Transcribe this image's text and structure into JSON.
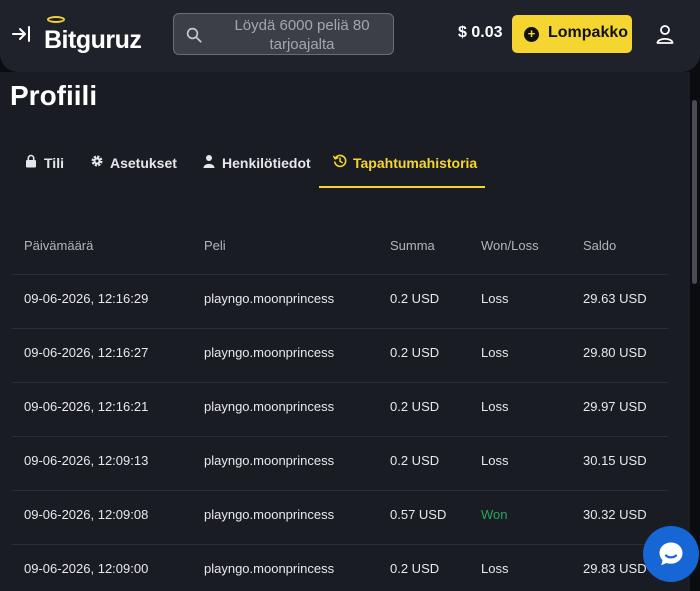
{
  "header": {
    "logo_text": "Bitguruz",
    "search_placeholder": "Löydä 6000 peliä 80 tarjoajalta",
    "balance": "$ 0.03",
    "wallet_label": "Lompakko",
    "wallet_plus": "+",
    "icons": {
      "collapse": "arrow-right-bar-icon",
      "search": "search-icon",
      "wallet": "plus-circle-icon",
      "user": "user-icon"
    }
  },
  "page": {
    "title": "Profiili",
    "tabs": [
      {
        "label": "Tili",
        "icon": "lock-icon",
        "active": false
      },
      {
        "label": "Asetukset",
        "icon": "gear-icon",
        "active": false
      },
      {
        "label": "Henkilötiedot",
        "icon": "person-icon",
        "active": false
      },
      {
        "label": "Tapahtumahistoria",
        "icon": "history-icon",
        "active": true
      }
    ]
  },
  "table": {
    "columns": [
      "Päivämäärä",
      "Peli",
      "Summa",
      "Won/Loss",
      "Saldo"
    ],
    "rows": [
      [
        "09-06-2026, 12:16:29",
        "playngo.moonprincess",
        "0.2 USD",
        "Loss",
        "29.63 USD"
      ],
      [
        "09-06-2026, 12:16:27",
        "playngo.moonprincess",
        "0.2 USD",
        "Loss",
        "29.80 USD"
      ],
      [
        "09-06-2026, 12:16:21",
        "playngo.moonprincess",
        "0.2 USD",
        "Loss",
        "29.97 USD"
      ],
      [
        "09-06-2026, 12:09:13",
        "playngo.moonprincess",
        "0.2 USD",
        "Loss",
        "30.15 USD"
      ],
      [
        "09-06-2026, 12:09:08",
        "playngo.moonprincess",
        "0.57 USD",
        "Won",
        "30.32 USD"
      ],
      [
        "09-06-2026, 12:09:00",
        "playngo.moonprincess",
        "0.2 USD",
        "Loss",
        "29.83 USD"
      ]
    ]
  },
  "colors": {
    "accent": "#f5d630",
    "won": "#26a65b",
    "chat": "#1766d6",
    "background": "#1a1c23"
  }
}
